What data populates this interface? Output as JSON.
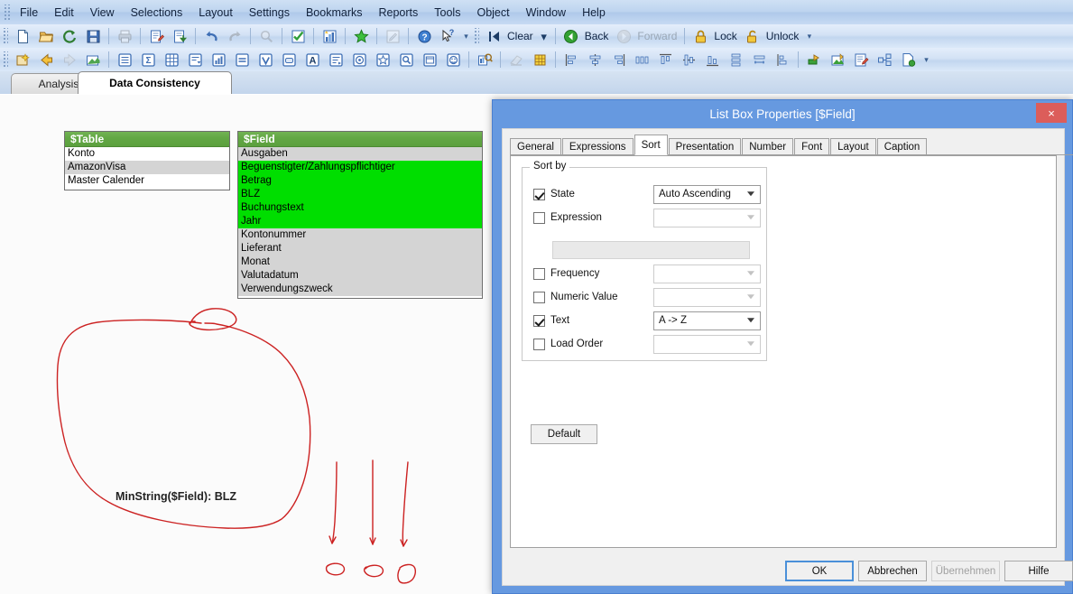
{
  "app": {
    "menus": [
      "File",
      "Edit",
      "View",
      "Selections",
      "Layout",
      "Settings",
      "Bookmarks",
      "Reports",
      "Tools",
      "Object",
      "Window",
      "Help"
    ]
  },
  "toolbar_standard": {
    "icons": [
      "new-document-icon",
      "open-folder-icon",
      "reload-icon",
      "save-icon",
      "print-icon",
      "edit-script-icon",
      "load-data-icon",
      "undo-icon",
      "redo-icon",
      "search-icon",
      "select-icon",
      "chart-wizard-icon",
      "favorite-icon",
      "edit-module-icon",
      "help-icon",
      "context-help-icon"
    ]
  },
  "toolbar_navigation": {
    "clear_label": "Clear",
    "back_label": "Back",
    "forward_label": "Forward",
    "lock_label": "Lock",
    "unlock_label": "Unlock",
    "icons": [
      "clear-icon",
      "back-icon",
      "forward-icon",
      "lock-icon",
      "unlock-icon"
    ]
  },
  "toolbar_design": {
    "icons": [
      "new-sheet-icon",
      "previous-sheet-icon",
      "next-sheet-icon",
      "sheet-properties-icon",
      "list-box-icon",
      "statistics-box-icon",
      "table-box-icon",
      "multi-box-icon",
      "chart-icon",
      "input-box-icon",
      "current-selections-icon",
      "button-icon",
      "text-object-icon",
      "line-arrow-icon",
      "slider-calendar-icon",
      "bookmark-object-icon",
      "search-object-icon",
      "container-icon",
      "custom-object-icon",
      "object-properties-icon",
      "eraser-icon",
      "grid-icon",
      "align-left-icon",
      "align-center-h-icon",
      "align-right-icon",
      "distribute-h-icon",
      "align-top-icon",
      "align-middle-icon",
      "align-bottom-icon",
      "distribute-v-icon",
      "space-equal-icon",
      "adjust-icon",
      "export-icon",
      "send-to-excel-icon",
      "edit-expression-icon",
      "layout-icon",
      "add-sheet-icon"
    ]
  },
  "sheets": {
    "tabs": [
      {
        "label": "Analysis",
        "active": false
      },
      {
        "label": "Data Consistency",
        "active": true
      }
    ]
  },
  "table_listbox": {
    "caption": "$Table",
    "rows": [
      {
        "value": "Konto",
        "state": "optional"
      },
      {
        "value": "AmazonVisa",
        "state": "excluded"
      },
      {
        "value": "Master Calender",
        "state": "optional"
      }
    ]
  },
  "field_listbox": {
    "caption": "$Field",
    "rows": [
      {
        "value": "Ausgaben",
        "state": "excluded"
      },
      {
        "value": "Beguenstigter/Zahlungspflichtiger",
        "state": "selected"
      },
      {
        "value": "Betrag",
        "state": "selected"
      },
      {
        "value": "BLZ",
        "state": "selected"
      },
      {
        "value": "Buchungstext",
        "state": "selected"
      },
      {
        "value": "Jahr",
        "state": "selected"
      },
      {
        "value": "Kontonummer",
        "state": "excluded"
      },
      {
        "value": "Lieferant",
        "state": "excluded"
      },
      {
        "value": "Monat",
        "state": "excluded"
      },
      {
        "value": "Valutadatum",
        "state": "excluded"
      },
      {
        "value": "Verwendungszweck",
        "state": "excluded"
      }
    ]
  },
  "annotation": {
    "text": "MinString($Field): BLZ",
    "ink_color": "#cc2222"
  },
  "dialog": {
    "title": "List Box Properties [$Field]",
    "close_label": "×",
    "tabs": [
      {
        "label": "General",
        "active": false
      },
      {
        "label": "Expressions",
        "active": false
      },
      {
        "label": "Sort",
        "active": true
      },
      {
        "label": "Presentation",
        "active": false
      },
      {
        "label": "Number",
        "active": false
      },
      {
        "label": "Font",
        "active": false
      },
      {
        "label": "Layout",
        "active": false
      },
      {
        "label": "Caption",
        "active": false
      }
    ],
    "sort_group": {
      "legend": "Sort by",
      "rows": [
        {
          "label": "State",
          "checked": true,
          "value": "Auto Ascending",
          "enabled": true
        },
        {
          "label": "Expression",
          "checked": false,
          "value": "",
          "enabled": false
        },
        {
          "label": "Frequency",
          "checked": false,
          "value": "",
          "enabled": false
        },
        {
          "label": "Numeric Value",
          "checked": false,
          "value": "",
          "enabled": false
        },
        {
          "label": "Text",
          "checked": true,
          "value": "A -> Z",
          "enabled": true
        },
        {
          "label": "Load Order",
          "checked": false,
          "value": "",
          "enabled": false
        }
      ],
      "expression_field_value": ""
    },
    "default_button": "Default",
    "footer": {
      "ok": "OK",
      "cancel": "Abbrechen",
      "apply": "Übernehmen",
      "help": "Hilfe"
    }
  },
  "colors": {
    "green_selected": "#00de00",
    "grey_excluded": "#d4d4d4",
    "caption_green": "#63a845",
    "dialog_blue": "#6699e0",
    "close_red": "#dc5d5a",
    "ink_red": "#cc2222"
  }
}
